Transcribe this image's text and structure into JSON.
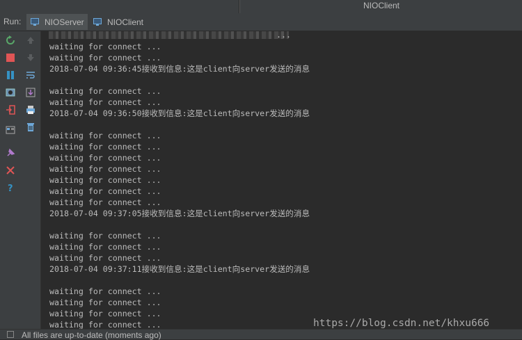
{
  "window": {
    "title": "NIOClient"
  },
  "runbar": {
    "label": "Run:",
    "tabs": [
      {
        "label": "NIOServer",
        "active": true
      },
      {
        "label": "NIOClient",
        "active": false
      }
    ]
  },
  "console": {
    "partial_top_text": "...",
    "lines": [
      "waiting for connect ...",
      "waiting for connect ...",
      "2018-07-04 09:36:45接收到信息:这是client向server发送的消息",
      "",
      "waiting for connect ...",
      "waiting for connect ...",
      "2018-07-04 09:36:50接收到信息:这是client向server发送的消息",
      "",
      "waiting for connect ...",
      "waiting for connect ...",
      "waiting for connect ...",
      "waiting for connect ...",
      "waiting for connect ...",
      "waiting for connect ...",
      "waiting for connect ...",
      "2018-07-04 09:37:05接收到信息:这是client向server发送的消息",
      "",
      "waiting for connect ...",
      "waiting for connect ...",
      "waiting for connect ...",
      "2018-07-04 09:37:11接收到信息:这是client向server发送的消息",
      "",
      "waiting for connect ...",
      "waiting for connect ...",
      "waiting for connect ...",
      "waiting for connect ..."
    ]
  },
  "status": {
    "text": "All files are up-to-date (moments ago)"
  },
  "watermark": "https://blog.csdn.net/khxu666",
  "colors": {
    "background": "#2b2b2b",
    "panel": "#3c3f41",
    "text": "#bbbbbb",
    "rerun": "#59a869",
    "stop": "#e05555",
    "pause": "#3592c4"
  },
  "toolbar_icons": [
    "rerun-icon",
    "stop-icon",
    "pause-icon",
    "dump-threads-icon",
    "exit-icon",
    "layout-icon",
    "pin-icon",
    "close-icon",
    "help-icon",
    "up-arrow-icon",
    "down-arrow-icon",
    "soft-wrap-icon",
    "scroll-to-end-icon",
    "print-icon",
    "clear-all-icon"
  ]
}
